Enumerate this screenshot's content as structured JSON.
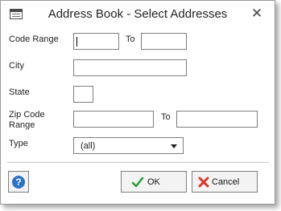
{
  "window": {
    "title": "Address Book - Select Addresses",
    "close_glyph": "✕",
    "app_icon": "address-book-icon"
  },
  "form": {
    "code_range": {
      "label": "Code Range",
      "from_value": "",
      "to_label": "To",
      "to_value": ""
    },
    "city": {
      "label": "City",
      "value": ""
    },
    "state": {
      "label": "State",
      "value": ""
    },
    "zip_range": {
      "label_line1": "Zip Code",
      "label_line2": "Range",
      "from_value": "",
      "to_label": "To",
      "to_value": ""
    },
    "type": {
      "label": "Type",
      "selected": "(all)"
    }
  },
  "buttons": {
    "help_glyph": "?",
    "ok_label": "OK",
    "cancel_label": "Cancel"
  },
  "colors": {
    "ok_check": "#2e9e3a",
    "cancel_x": "#d93a2b",
    "help_circle": "#2b73c7"
  }
}
